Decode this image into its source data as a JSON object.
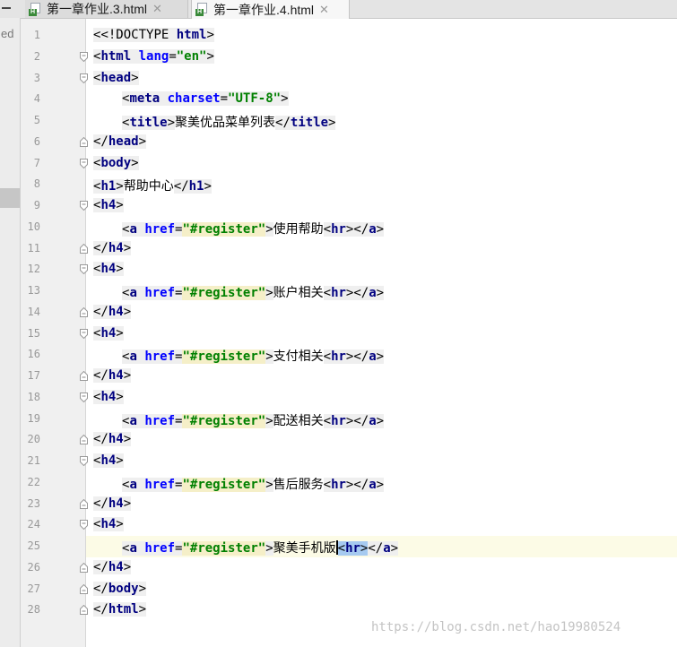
{
  "tabs": [
    {
      "label": "第一章作业.3.html",
      "active": false
    },
    {
      "label": "第一章作业.4.html",
      "active": true
    }
  ],
  "left_panel": {
    "partial_text": "ed"
  },
  "editor": {
    "current_line": 25,
    "line_numbers": [
      "1",
      "2",
      "3",
      "4",
      "5",
      "6",
      "7",
      "8",
      "9",
      "10",
      "11",
      "12",
      "13",
      "14",
      "15",
      "16",
      "17",
      "18",
      "19",
      "20",
      "21",
      "22",
      "23",
      "24",
      "25",
      "26",
      "27",
      "28"
    ],
    "lines": [
      "<!DOCTYPE html>",
      "<html lang=\"en\">",
      "<head>",
      "<meta charset=\"UTF-8\">",
      "<title>聚美优品菜单列表</title>",
      "</head>",
      "<body>",
      "<h1>帮助中心</h1>",
      "<h4>",
      "<a href=\"#register\">使用帮助<hr></a>",
      "</h4>",
      "<h4>",
      "<a href=\"#register\">账户相关<hr></a>",
      "</h4>",
      "<h4>",
      "<a href=\"#register\">支付相关<hr></a>",
      "</h4>",
      "<h4>",
      "<a href=\"#register\">配送相关<hr></a>",
      "</h4>",
      "<h4>",
      "<a href=\"#register\">售后服务<hr></a>",
      "</h4>",
      "<h4>",
      "<a href=\"#register\">聚美手机版<hr></a>",
      "</h4>",
      "</body>",
      "</html>"
    ],
    "tokens": {
      "doctype": "<!DOCTYPE",
      "html": "html",
      "lang_attr": "lang",
      "lang_val": "\"en\"",
      "head": "head",
      "meta": "meta",
      "charset_attr": "charset",
      "charset_val": "\"UTF-8\"",
      "title": "title",
      "title_text": "聚美优品菜单列表",
      "body": "body",
      "h1": "h1",
      "h1_text": "帮助中心",
      "h4": "h4",
      "a": "a",
      "href_attr": "href",
      "href_val": "\"#register\"",
      "hr": "hr",
      "link_texts": [
        "使用帮助",
        "账户相关",
        "支付相关",
        "配送相关",
        "售后服务",
        "聚美手机版"
      ]
    }
  },
  "watermark": "https://blog.csdn.net/hao19980524",
  "colors": {
    "tag": "#000080",
    "attribute": "#0000ff",
    "string": "#008000",
    "current_line_bg": "#fcfbe6",
    "selection": "#a6caf0"
  }
}
